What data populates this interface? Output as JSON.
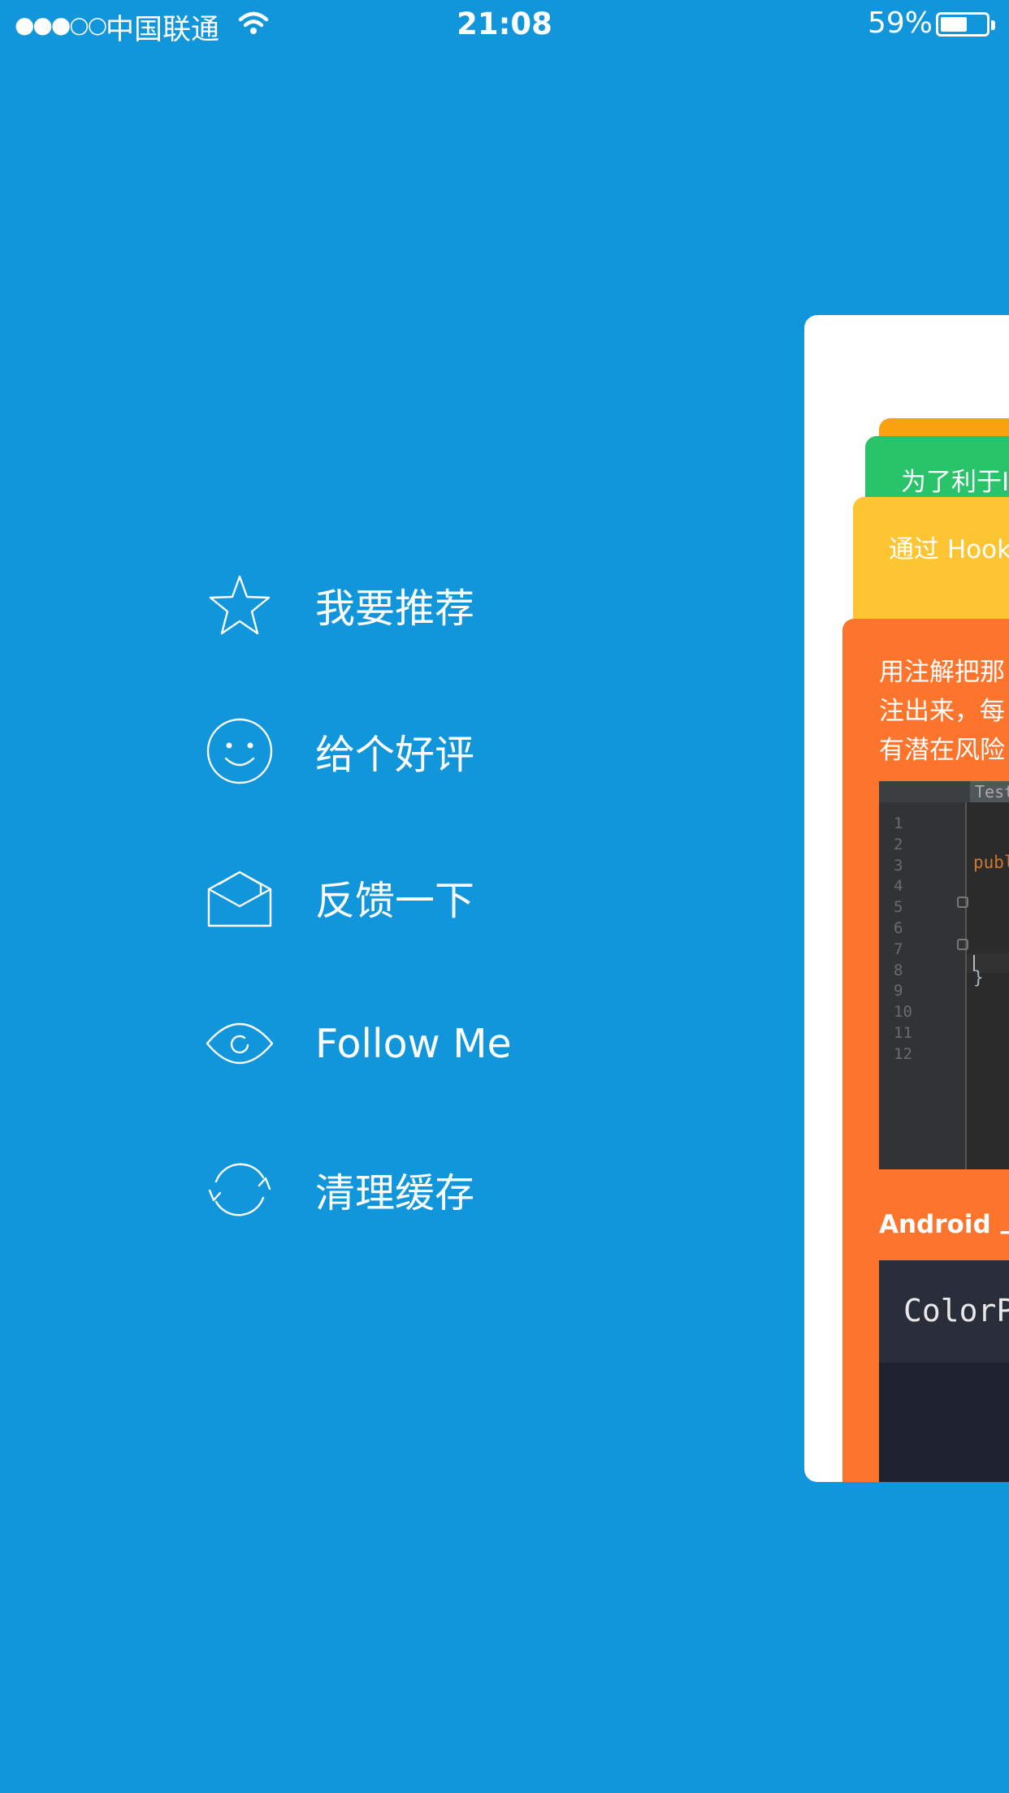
{
  "status_bar": {
    "signal": "●●●○○",
    "carrier": "中国联通",
    "time": "21:08",
    "battery_percent": "59%",
    "battery_level": 0.59
  },
  "menu": {
    "items": [
      {
        "label": "我要推荐",
        "icon": "star-icon"
      },
      {
        "label": "给个好评",
        "icon": "smiley-icon"
      },
      {
        "label": "反馈一下",
        "icon": "envelope-icon"
      },
      {
        "label": "Follow Me",
        "icon": "eye-icon"
      },
      {
        "label": "清理缓存",
        "icon": "refresh-icon"
      }
    ]
  },
  "preview": {
    "green_card_text": "为了利于I",
    "yellow_card_text": "通过 Hook",
    "main_card": {
      "lines": [
        "用注解把那",
        "注出来，每",
        "有潜在风险"
      ],
      "code_tab": "Test",
      "line_numbers": "1\n2\n3\n4\n5\n6\n7\n8\n9\n10\n11\n12",
      "code_keyword": "publ",
      "code_brace": "}",
      "android_text": "Android 上",
      "color_text": "ColorP"
    }
  },
  "colors": {
    "background": "#1296db",
    "card_orange": "#fd742c",
    "card_yellow": "#fcc531",
    "card_green": "#29c36a",
    "card_orange_top": "#f7a20e"
  }
}
